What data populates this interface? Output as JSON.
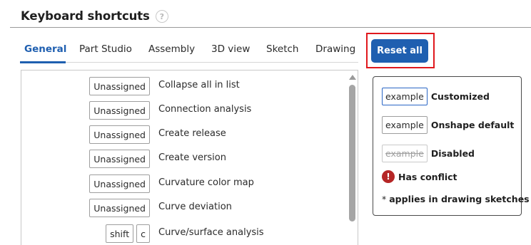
{
  "header": {
    "title": "Keyboard shortcuts",
    "help_icon": "question-circle-icon"
  },
  "tabs": [
    {
      "label": "General",
      "active": true
    },
    {
      "label": "Part Studio",
      "active": false
    },
    {
      "label": "Assembly",
      "active": false
    },
    {
      "label": "3D view",
      "active": false
    },
    {
      "label": "Sketch",
      "active": false
    },
    {
      "label": "Drawing",
      "active": false
    }
  ],
  "reset_button": {
    "label": "Reset all"
  },
  "shortcuts": [
    {
      "keys": [
        "Unassigned"
      ],
      "command": "Collapse all in list"
    },
    {
      "keys": [
        "Unassigned"
      ],
      "command": "Connection analysis"
    },
    {
      "keys": [
        "Unassigned"
      ],
      "command": "Create release"
    },
    {
      "keys": [
        "Unassigned"
      ],
      "command": "Create version"
    },
    {
      "keys": [
        "Unassigned"
      ],
      "command": "Curvature color map"
    },
    {
      "keys": [
        "Unassigned"
      ],
      "command": "Curve deviation"
    },
    {
      "keys": [
        "shift",
        "c"
      ],
      "command": "Curve/surface analysis"
    }
  ],
  "legend": {
    "customized": {
      "key": "example",
      "label": "Customized"
    },
    "default": {
      "key": "example",
      "label": "Onshape default"
    },
    "disabled": {
      "key": "example",
      "label": "Disabled"
    },
    "conflict": {
      "icon": "exclamation-circle-icon",
      "symbol": "!",
      "label": "Has conflict"
    },
    "footnote": {
      "marker": "*",
      "text": "applies in drawing sketches"
    }
  },
  "colors": {
    "accent": "#1f5fb0",
    "highlight_frame": "#e0181d",
    "conflict": "#b52626"
  }
}
